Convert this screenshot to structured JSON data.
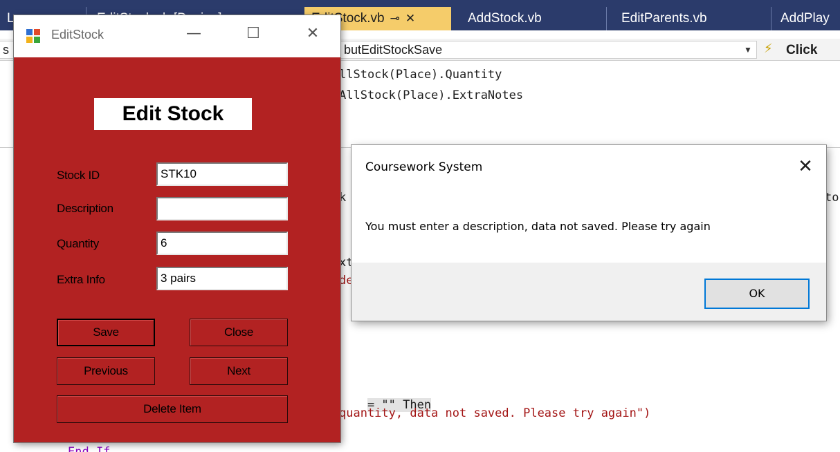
{
  "ide": {
    "tabs": [
      {
        "label": "Log...",
        "active": false
      },
      {
        "label": "EditStock.vb [Design]",
        "active": false
      },
      {
        "label": "EditStock.vb",
        "active": true
      },
      {
        "label": "AddStock.vb",
        "active": false
      },
      {
        "label": "EditParents.vb",
        "active": false
      },
      {
        "label": "AddPlay",
        "active": false
      }
    ],
    "nav_left": "s",
    "nav_method": "butEditStockSave",
    "nav_event": "Click",
    "code_lines": [
      "llStock(Place).Quantity",
      "AllStock(Place).ExtraNotes",
      "k",
      "xt",
      "de",
      "= \"\" Then",
      "quantity, data not saved. Please try again\")",
      "End If",
      "to"
    ]
  },
  "form": {
    "window_title": "EditStock",
    "heading": "Edit Stock",
    "fields": {
      "stock_id": {
        "label": "Stock ID",
        "value": "STK10"
      },
      "description": {
        "label": "Description",
        "value": ""
      },
      "quantity": {
        "label": "Quantity",
        "value": "6"
      },
      "extra_info": {
        "label": "Extra Info",
        "value": "3 pairs"
      }
    },
    "buttons": {
      "save": "Save",
      "close": "Close",
      "previous": "Previous",
      "next": "Next",
      "delete": "Delete Item"
    },
    "colors": {
      "background": "#b22222"
    }
  },
  "dialog": {
    "title": "Coursework System",
    "message": "You must enter a description, data not saved. Please try again",
    "ok_label": "OK"
  }
}
